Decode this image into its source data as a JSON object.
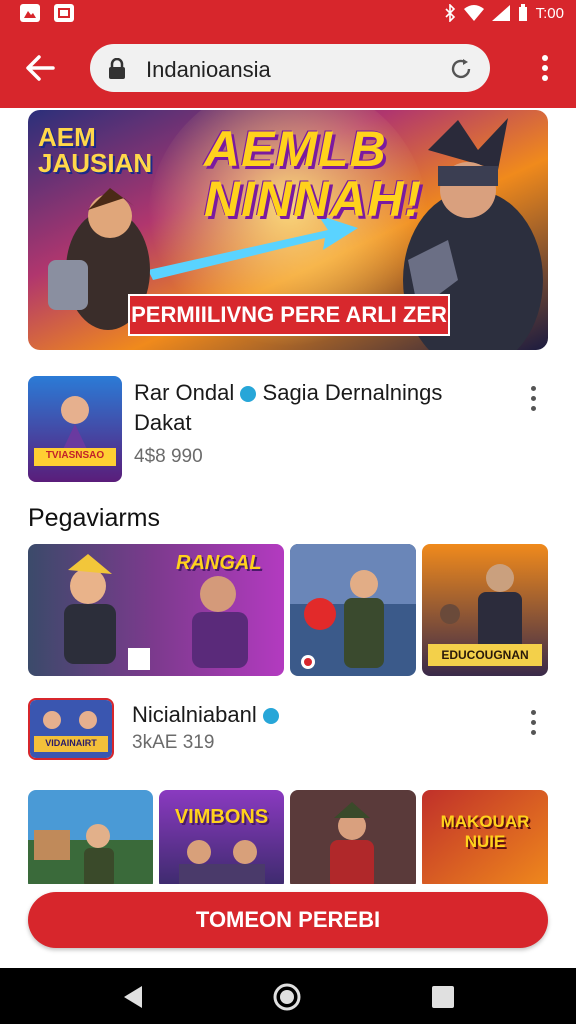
{
  "status_bar": {
    "time": "T:00",
    "icons": [
      "photo-icon",
      "image-icon",
      "bluetooth-icon",
      "wifi-icon",
      "signal-icon",
      "battery-icon"
    ]
  },
  "app_bar": {
    "url": "Indanioansia",
    "icons": [
      "back-arrow-icon",
      "lock-icon",
      "reload-icon",
      "overflow-menu-icon"
    ]
  },
  "hero": {
    "logo_text": "AEM\nJAUSIAN",
    "title_line1": "AEMLB",
    "title_line2": "NINNAH!",
    "banner": "PERMIILIVNG PERE ARLI ZER"
  },
  "channel1": {
    "name": "Rar Ondal",
    "subtitle": "Sagia Dernalnings",
    "name_line2": "Dakat",
    "meta": "4$8 990",
    "thumb_text": "TVIASNSAO"
  },
  "section": {
    "title": "Pegaviarms"
  },
  "tiles_row1": [
    {
      "label": ""
    },
    {
      "label": "RANGAL"
    },
    {
      "label": ""
    },
    {
      "label": "EDUCOUGNAN"
    }
  ],
  "channel2": {
    "name": "Nicialniabanl",
    "meta": "3kAE 319",
    "thumb_text": "VIDAINAIRT"
  },
  "tiles_row2": [
    {
      "label": ""
    },
    {
      "label": "VIMBONS"
    },
    {
      "label": ""
    },
    {
      "label": "MAKOUAR\nNUIE"
    }
  ],
  "cta": {
    "label": "TOMEON PEREBI"
  },
  "nav": {
    "icons": [
      "back-triangle-icon",
      "home-circle-icon",
      "recents-square-icon"
    ]
  },
  "colors": {
    "accent": "#d7262c",
    "verified": "#27a6d8"
  }
}
